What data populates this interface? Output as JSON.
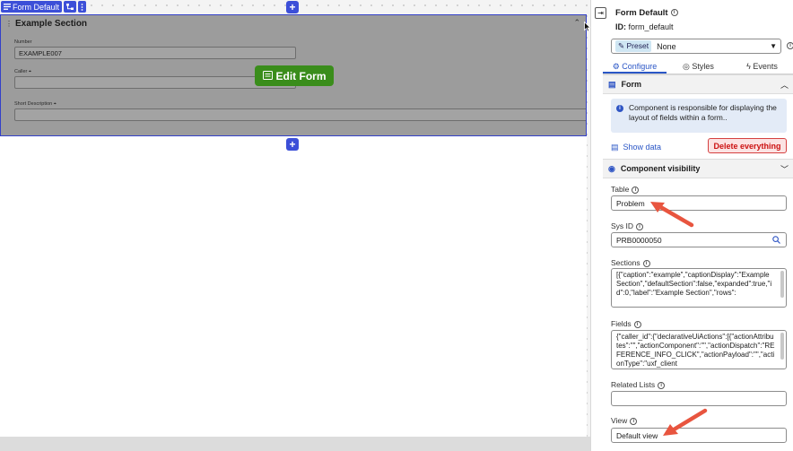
{
  "canvas": {
    "toolbar": {
      "component_label": "Form Default"
    },
    "section_title": "Example Section",
    "fields": [
      {
        "label": "Number",
        "value": "EXAMPLE007"
      },
      {
        "label": "Caller",
        "value": ""
      },
      {
        "label": "Short Description",
        "value": ""
      }
    ],
    "edit_form_label": "Edit Form"
  },
  "panel": {
    "title": "Form Default",
    "id_label": "ID:",
    "id_value": "form_default",
    "preset_chip": "Preset",
    "preset_value": "None",
    "tabs": [
      {
        "label": "Configure",
        "active": true
      },
      {
        "label": "Styles",
        "active": false
      },
      {
        "label": "Events",
        "active": false
      }
    ],
    "form_section": {
      "title": "Form",
      "info_text": "Component is responsible for displaying the layout of fields within a form..",
      "show_data_label": "Show data",
      "delete_label": "Delete everything"
    },
    "visibility_title": "Component visibility",
    "fields": {
      "table": {
        "label": "Table",
        "value": "Problem"
      },
      "sys_id": {
        "label": "Sys ID",
        "value": "PRB0000050"
      },
      "sections": {
        "label": "Sections",
        "value": "[{\"caption\":\"example\",\"captionDisplay\":\"Example Section\",\"defaultSection\":false,\"expanded\":true,\"id\":0,\"label\":\"Example Section\",\"rows\":"
      },
      "fields": {
        "label": "Fields",
        "value": "{\"caller_id\":{\"declarativeUiActions\":[{\"actionAttributes\":\"\",\"actionComponent\":\"\",\"actionDispatch\":\"REFERENCE_INFO_CLICK\",\"actionPayload\":\"\",\"actionType\":\"uxf_client"
      },
      "related_lists": {
        "label": "Related Lists",
        "value": ""
      },
      "view": {
        "label": "View",
        "value": "Default view"
      }
    }
  },
  "colors": {
    "accent_blue": "#3c4fd8",
    "edit_green": "#3a8d1b",
    "delete_red": "#d54040",
    "arrow_red": "#e8553f"
  }
}
